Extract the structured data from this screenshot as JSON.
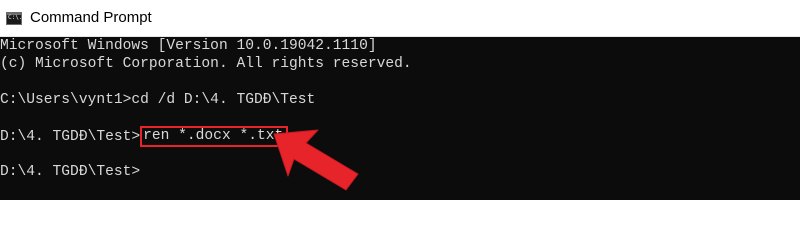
{
  "window": {
    "title": "Command Prompt",
    "icon": "cmd-icon",
    "icon_text": "C:\\."
  },
  "console": {
    "lines": [
      "Microsoft Windows [Version 10.0.19042.1110]",
      "(c) Microsoft Corporation. All rights reserved.",
      "C:\\Users\\vynt1>cd /d D:\\4. TGDĐ\\Test",
      "D:\\4. TGDĐ\\Test>",
      "D:\\4. TGDĐ\\Test>"
    ],
    "highlighted_command": "ren *.docx *.txt"
  },
  "annotation": {
    "arrow_color": "#e8242b",
    "highlight_color": "#e8242b",
    "icon": "red-arrow-icon"
  },
  "colors": {
    "console_bg": "#0c0c0c",
    "console_text": "#d8d8d8",
    "titlebar_bg": "#ffffff"
  }
}
